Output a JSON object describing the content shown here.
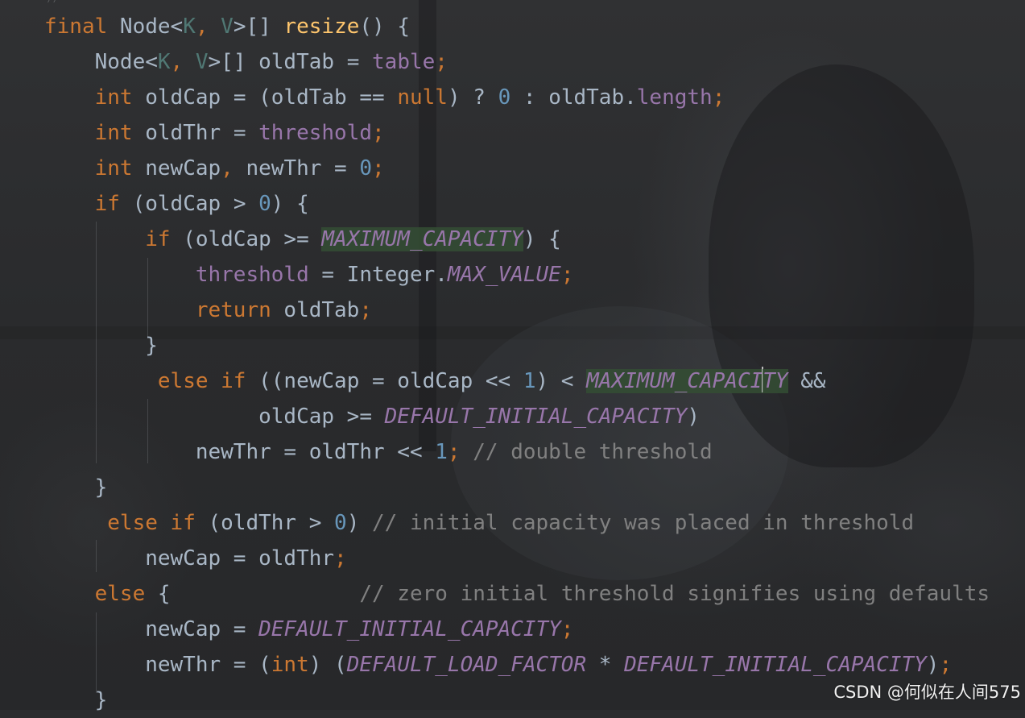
{
  "editor": {
    "lines": [
      [
        {
          "t": "final",
          "c": "kw"
        },
        {
          "t": " Node<",
          "c": ""
        },
        {
          "t": "K",
          "c": "tp"
        },
        {
          "t": ", ",
          "c": "punc"
        },
        {
          "t": "V",
          "c": "tp"
        },
        {
          "t": ">[] ",
          "c": ""
        },
        {
          "t": "resize",
          "c": "method"
        },
        {
          "t": "() {",
          "c": ""
        }
      ],
      [
        {
          "t": "    Node<",
          "c": ""
        },
        {
          "t": "K",
          "c": "tp"
        },
        {
          "t": ", ",
          "c": "punc"
        },
        {
          "t": "V",
          "c": "tp"
        },
        {
          "t": ">[] oldTab = ",
          "c": ""
        },
        {
          "t": "table",
          "c": "field"
        },
        {
          "t": ";",
          "c": "punc"
        }
      ],
      [
        {
          "t": "    ",
          "c": ""
        },
        {
          "t": "int",
          "c": "kw"
        },
        {
          "t": " oldCap = (oldTab == ",
          "c": ""
        },
        {
          "t": "null",
          "c": "kw"
        },
        {
          "t": ") ? ",
          "c": ""
        },
        {
          "t": "0",
          "c": "num"
        },
        {
          "t": " : oldTab.",
          "c": ""
        },
        {
          "t": "length",
          "c": "field"
        },
        {
          "t": ";",
          "c": "punc"
        }
      ],
      [
        {
          "t": "    ",
          "c": ""
        },
        {
          "t": "int",
          "c": "kw"
        },
        {
          "t": " oldThr = ",
          "c": ""
        },
        {
          "t": "threshold",
          "c": "field"
        },
        {
          "t": ";",
          "c": "punc"
        }
      ],
      [
        {
          "t": "    ",
          "c": ""
        },
        {
          "t": "int",
          "c": "kw"
        },
        {
          "t": " newCap",
          "c": ""
        },
        {
          "t": ",",
          "c": "punc"
        },
        {
          "t": " newThr = ",
          "c": ""
        },
        {
          "t": "0",
          "c": "num"
        },
        {
          "t": ";",
          "c": "punc"
        }
      ],
      [
        {
          "t": "    ",
          "c": ""
        },
        {
          "t": "if",
          "c": "kw"
        },
        {
          "t": " (oldCap > ",
          "c": ""
        },
        {
          "t": "0",
          "c": "num"
        },
        {
          "t": ") {",
          "c": ""
        }
      ],
      [
        {
          "t": "        ",
          "c": ""
        },
        {
          "t": "if",
          "c": "kw"
        },
        {
          "t": " (oldCap >= ",
          "c": ""
        },
        {
          "t": "MAXIMUM_CAPACITY",
          "c": "const hl"
        },
        {
          "t": ") {",
          "c": ""
        }
      ],
      [
        {
          "t": "            ",
          "c": ""
        },
        {
          "t": "threshold",
          "c": "field"
        },
        {
          "t": " = Integer.",
          "c": ""
        },
        {
          "t": "MAX_VALUE",
          "c": "const"
        },
        {
          "t": ";",
          "c": "punc"
        }
      ],
      [
        {
          "t": "            ",
          "c": ""
        },
        {
          "t": "return",
          "c": "kw"
        },
        {
          "t": " oldTab",
          "c": ""
        },
        {
          "t": ";",
          "c": "punc"
        }
      ],
      [
        {
          "t": "        }",
          "c": ""
        }
      ],
      [
        {
          "t": "         ",
          "c": ""
        },
        {
          "t": "else if",
          "c": "kw"
        },
        {
          "t": " ((newCap = oldCap << ",
          "c": ""
        },
        {
          "t": "1",
          "c": "num"
        },
        {
          "t": ") < ",
          "c": ""
        },
        {
          "t": "MAXIMUM_CAPACI",
          "c": "const hl"
        },
        {
          "t": "CARET",
          "c": "caret"
        },
        {
          "t": "TY",
          "c": "const hl"
        },
        {
          "t": " &&",
          "c": ""
        }
      ],
      [
        {
          "t": "                 oldCap >= ",
          "c": ""
        },
        {
          "t": "DEFAULT_INITIAL_CAPACITY",
          "c": "const"
        },
        {
          "t": ")",
          "c": ""
        }
      ],
      [
        {
          "t": "            newThr = oldThr << ",
          "c": ""
        },
        {
          "t": "1",
          "c": "num"
        },
        {
          "t": "; ",
          "c": "punc"
        },
        {
          "t": "// double threshold",
          "c": "comment"
        }
      ],
      [
        {
          "t": "    }",
          "c": ""
        }
      ],
      [
        {
          "t": "     ",
          "c": ""
        },
        {
          "t": "else if",
          "c": "kw"
        },
        {
          "t": " (oldThr > ",
          "c": ""
        },
        {
          "t": "0",
          "c": "num"
        },
        {
          "t": ") ",
          "c": ""
        },
        {
          "t": "// initial capacity was placed in threshold",
          "c": "comment"
        }
      ],
      [
        {
          "t": "        newCap = oldThr",
          "c": ""
        },
        {
          "t": ";",
          "c": "punc"
        }
      ],
      [
        {
          "t": "    ",
          "c": ""
        },
        {
          "t": "else",
          "c": "kw"
        },
        {
          "t": " {               ",
          "c": ""
        },
        {
          "t": "// zero initial threshold signifies using defaults",
          "c": "comment"
        }
      ],
      [
        {
          "t": "        newCap = ",
          "c": ""
        },
        {
          "t": "DEFAULT_INITIAL_CAPACITY",
          "c": "const"
        },
        {
          "t": ";",
          "c": "punc"
        }
      ],
      [
        {
          "t": "        newThr = (",
          "c": ""
        },
        {
          "t": "int",
          "c": "kw"
        },
        {
          "t": ") (",
          "c": ""
        },
        {
          "t": "DEFAULT_LOAD_FACTOR",
          "c": "const"
        },
        {
          "t": " * ",
          "c": ""
        },
        {
          "t": "DEFAULT_INITIAL_CAPACITY",
          "c": "const"
        },
        {
          "t": ")",
          "c": ""
        },
        {
          "t": ";",
          "c": "punc"
        }
      ],
      [
        {
          "t": "    }",
          "c": ""
        }
      ]
    ]
  },
  "watermark": {
    "text": "CSDN @何似在人间575"
  },
  "colors": {
    "keyword": "#cc7832",
    "field": "#9876aa",
    "number": "#6897bb",
    "comment": "#808080",
    "method": "#ffc66d",
    "text": "#a9b7c6",
    "highlight": "#344e34"
  }
}
